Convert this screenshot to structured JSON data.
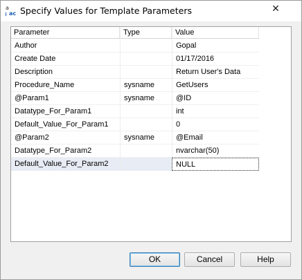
{
  "window": {
    "title": "Specify Values for Template Parameters",
    "close_glyph": "✕"
  },
  "grid": {
    "headers": [
      "Parameter",
      "Type",
      "Value"
    ],
    "rows": [
      {
        "parameter": "Author",
        "type": "",
        "value": "Gopal"
      },
      {
        "parameter": "Create Date",
        "type": "",
        "value": "01/17/2016"
      },
      {
        "parameter": "Description",
        "type": "",
        "value": "Return User's Data"
      },
      {
        "parameter": "Procedure_Name",
        "type": "sysname",
        "value": "GetUsers"
      },
      {
        "parameter": "@Param1",
        "type": "sysname",
        "value": "@ID"
      },
      {
        "parameter": "Datatype_For_Param1",
        "type": "",
        "value": "int"
      },
      {
        "parameter": "Default_Value_For_Param1",
        "type": "",
        "value": "0"
      },
      {
        "parameter": "@Param2",
        "type": "sysname",
        "value": "@Email"
      },
      {
        "parameter": "Datatype_For_Param2",
        "type": "",
        "value": "nvarchar(50)"
      },
      {
        "parameter": "Default_Value_For_Param2",
        "type": "",
        "value": "NULL"
      }
    ]
  },
  "buttons": {
    "ok": "OK",
    "cancel": "Cancel",
    "help": "Help"
  }
}
